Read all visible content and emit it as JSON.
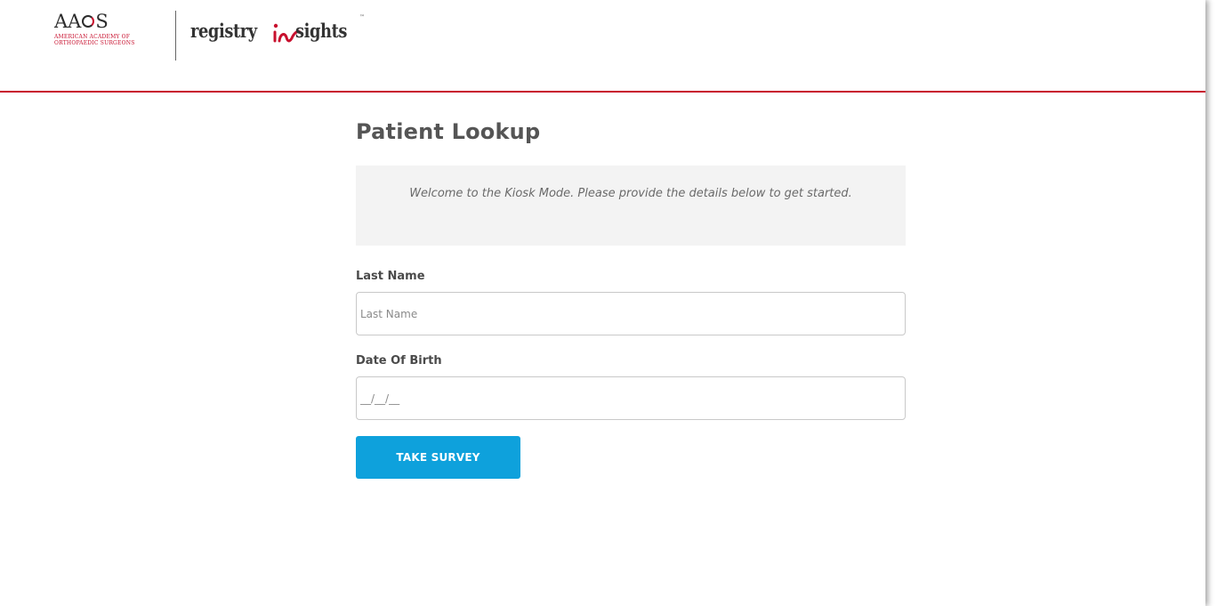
{
  "header": {
    "aaos_logo": {
      "mark_left": "AA",
      "mark_right": "S",
      "subtitle_line1": "American Academy of",
      "subtitle_line2": "Orthopaedic Surgeons"
    },
    "registry_logo": {
      "word_left": "registry",
      "word_right": "sights",
      "trademark": "™"
    },
    "divider_color": "#c8102e"
  },
  "main": {
    "title": "Patient Lookup",
    "welcome_message": "Welcome to the Kiosk Mode. Please provide the details below to get started.",
    "fields": [
      {
        "label": "Last Name",
        "placeholder": "Last Name",
        "value": ""
      },
      {
        "label": "Date Of Birth",
        "placeholder": "__/__/__",
        "value": ""
      }
    ],
    "submit_label": "TAKE SURVEY",
    "accent_color": "#0ea1dc"
  }
}
